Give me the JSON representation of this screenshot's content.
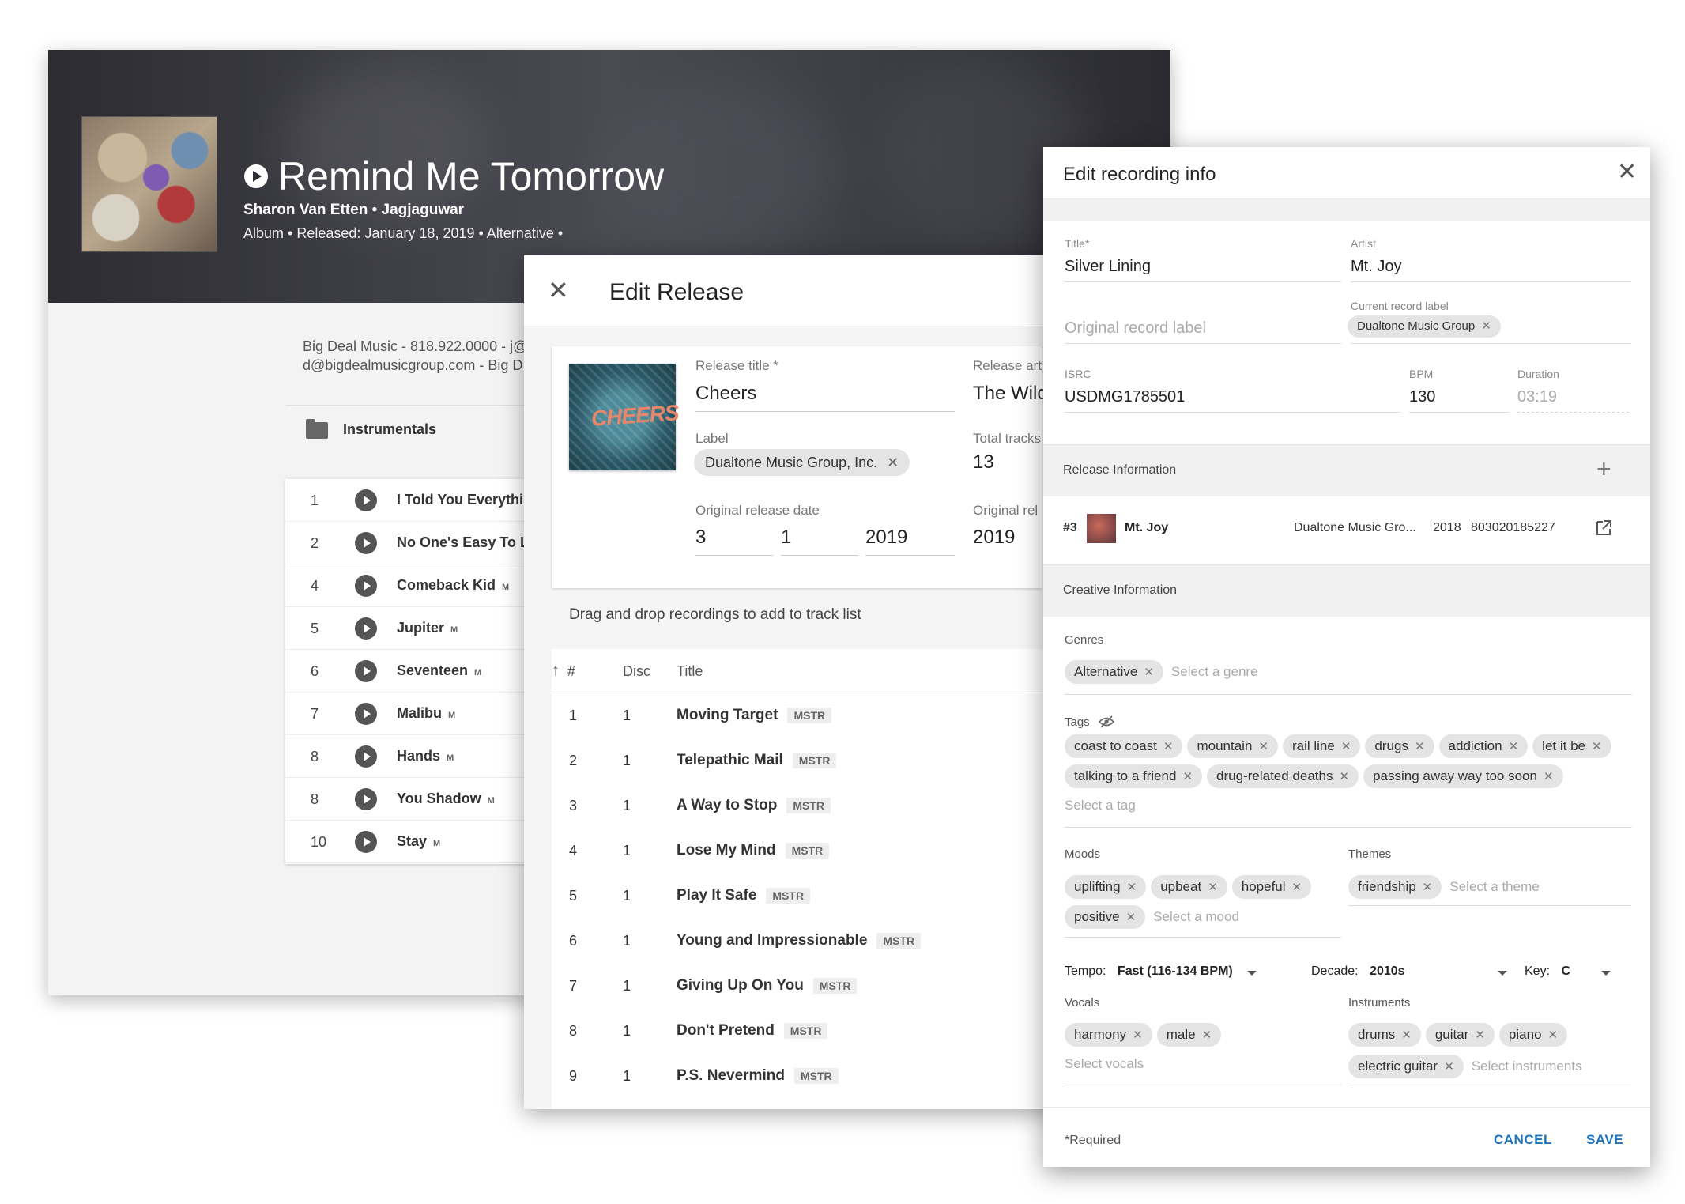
{
  "album": {
    "title": "Remind Me Tomorrow",
    "artist_line": "Sharon Van Etten  •  Jagjaguwar",
    "meta_line": "Album •  Released: January 18, 2019 •  Alternative •",
    "contact_line1": "Big Deal Music - 818.922.0000 - j@",
    "contact_line2": "d@bigdealmusicgroup.com - Big D",
    "folder_label": "Instrumentals",
    "tracks": [
      {
        "num": "1",
        "name": "I Told You Everythi",
        "m": ""
      },
      {
        "num": "2",
        "name": "No One's Easy To L",
        "m": ""
      },
      {
        "num": "4",
        "name": "Comeback Kid",
        "m": "M"
      },
      {
        "num": "5",
        "name": "Jupiter",
        "m": "M"
      },
      {
        "num": "6",
        "name": "Seventeen",
        "m": "M"
      },
      {
        "num": "7",
        "name": "Malibu",
        "m": "M"
      },
      {
        "num": "8",
        "name": "Hands",
        "m": "M"
      },
      {
        "num": "8",
        "name": "You Shadow",
        "m": "M"
      },
      {
        "num": "10",
        "name": "Stay",
        "m": "M"
      }
    ]
  },
  "release": {
    "dialog_title": "Edit Release",
    "close_glyph": "✕",
    "art_word": "CHEERS",
    "release_title_label": "Release title *",
    "release_title_value": "Cheers",
    "release_artist_label": "Release art",
    "release_artist_value": "The Wild",
    "label_label": "Label",
    "label_chip": "Dualtone Music Group, Inc.",
    "total_tracks_label": "Total tracks",
    "total_tracks_value": "13",
    "orig_release_date_label": "Original release date",
    "date_month": "3",
    "date_day": "1",
    "date_year": "2019",
    "orig_release_label": "Original rel",
    "orig_release_value": "2019",
    "dragdrop": "Drag and drop recordings to add to track list",
    "col_num": "#",
    "col_disc": "Disc",
    "col_title": "Title",
    "tracks": [
      {
        "n": "1",
        "d": "1",
        "t": "Moving Target",
        "b": "MSTR"
      },
      {
        "n": "2",
        "d": "1",
        "t": "Telepathic Mail",
        "b": "MSTR"
      },
      {
        "n": "3",
        "d": "1",
        "t": "A Way to Stop",
        "b": "MSTR"
      },
      {
        "n": "4",
        "d": "1",
        "t": "Lose My Mind",
        "b": "MSTR"
      },
      {
        "n": "5",
        "d": "1",
        "t": "Play It Safe",
        "b": "MSTR"
      },
      {
        "n": "6",
        "d": "1",
        "t": "Young and Impressionable",
        "b": "MSTR"
      },
      {
        "n": "7",
        "d": "1",
        "t": "Giving Up On You",
        "b": "MSTR"
      },
      {
        "n": "8",
        "d": "1",
        "t": "Don't Pretend",
        "b": "MSTR"
      },
      {
        "n": "9",
        "d": "1",
        "t": "P.S. Nevermind",
        "b": "MSTR"
      }
    ]
  },
  "recording": {
    "dialog_title": "Edit recording info",
    "close_glyph": "✕",
    "title_label": "Title*",
    "title_value": "Silver Lining",
    "artist_label": "Artist",
    "artist_value": "Mt. Joy",
    "orig_label_placeholder": "Original record label",
    "current_label_label": "Current record label",
    "current_label_chip": "Dualtone Music Group",
    "isrc_label": "ISRC",
    "isrc_value": "USDMG1785501",
    "bpm_label": "BPM",
    "bpm_value": "130",
    "duration_label": "Duration",
    "duration_value": "03:19",
    "release_info_label": "Release Information",
    "plus_glyph": "+",
    "release_row": {
      "num": "#3",
      "artist": "Mt. Joy",
      "label": "Dualtone Music Gro...",
      "year": "2018",
      "upc": "803020185227"
    },
    "creative_info_label": "Creative Information",
    "genres_label": "Genres",
    "genres": [
      "Alternative"
    ],
    "genres_placeholder": "Select a genre",
    "tags_label": "Tags",
    "tags_row1": [
      "coast to coast",
      "mountain",
      "rail line",
      "drugs",
      "addiction",
      "let it be"
    ],
    "tags_row2": [
      "talking to a friend",
      "drug-related deaths",
      "passing away way too soon"
    ],
    "tags_placeholder": "Select a tag",
    "moods_label": "Moods",
    "moods_row1": [
      "uplifting",
      "upbeat",
      "hopeful"
    ],
    "moods_row2": [
      "positive"
    ],
    "moods_placeholder": "Select a mood",
    "themes_label": "Themes",
    "themes": [
      "friendship"
    ],
    "themes_placeholder": "Select a theme",
    "tempo_label": "Tempo:",
    "tempo_value": "Fast (116-134 BPM)",
    "decade_label": "Decade:",
    "decade_value": "2010s",
    "key_label": "Key:",
    "key_value": "C",
    "vocals_label": "Vocals",
    "vocals": [
      "harmony",
      "male"
    ],
    "vocals_placeholder": "Select vocals",
    "instruments_label": "Instruments",
    "instruments_row1": [
      "drums",
      "guitar",
      "piano"
    ],
    "instruments_row2": [
      "electric guitar"
    ],
    "instruments_placeholder": "Select instruments",
    "required_note": "*Required",
    "cancel_label": "CANCEL",
    "save_label": "SAVE"
  },
  "colors": {
    "accent": "#1e73be",
    "chip_bg": "#e4e4e4",
    "section_bg": "#f1f1f1"
  }
}
